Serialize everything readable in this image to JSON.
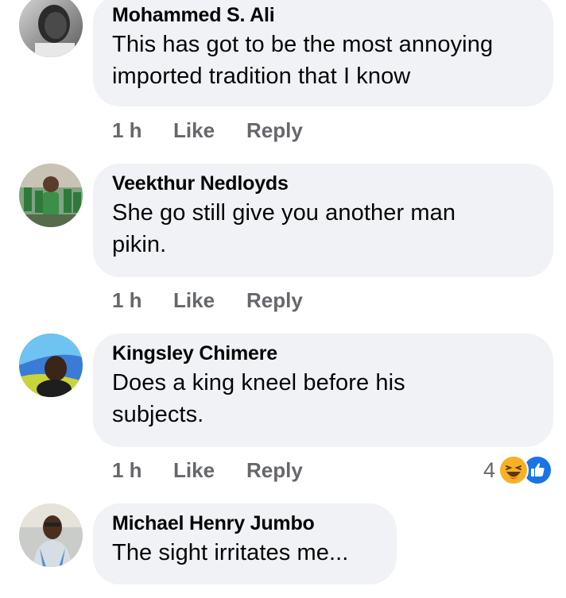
{
  "comments": [
    {
      "author": "Mohammed S. Ali",
      "text_lines": [
        "This has got to be the most annoying",
        "imported tradition that I know"
      ],
      "time": "1 h",
      "like_label": "Like",
      "reply_label": "Reply"
    },
    {
      "author": "Veekthur Nedloyds",
      "text_lines": [
        "She go still give you another man",
        "pikin."
      ],
      "time": "1 h",
      "like_label": "Like",
      "reply_label": "Reply"
    },
    {
      "author": "Kingsley Chimere",
      "text_lines": [
        "Does a king kneel before his",
        "subjects."
      ],
      "time": "1 h",
      "like_label": "Like",
      "reply_label": "Reply",
      "reaction_count": "4",
      "reaction_icons": [
        "haha-emoji-icon",
        "like-emoji-icon"
      ]
    },
    {
      "author": "Michael Henry Jumbo",
      "text_lines": [
        "The sight irritates me..."
      ]
    }
  ],
  "colors": {
    "bubble": "#f0f2f5",
    "text": "#050505",
    "secondary": "#65676b",
    "like_blue": "#1b74e4",
    "haha_yellow": "#f7b125"
  }
}
